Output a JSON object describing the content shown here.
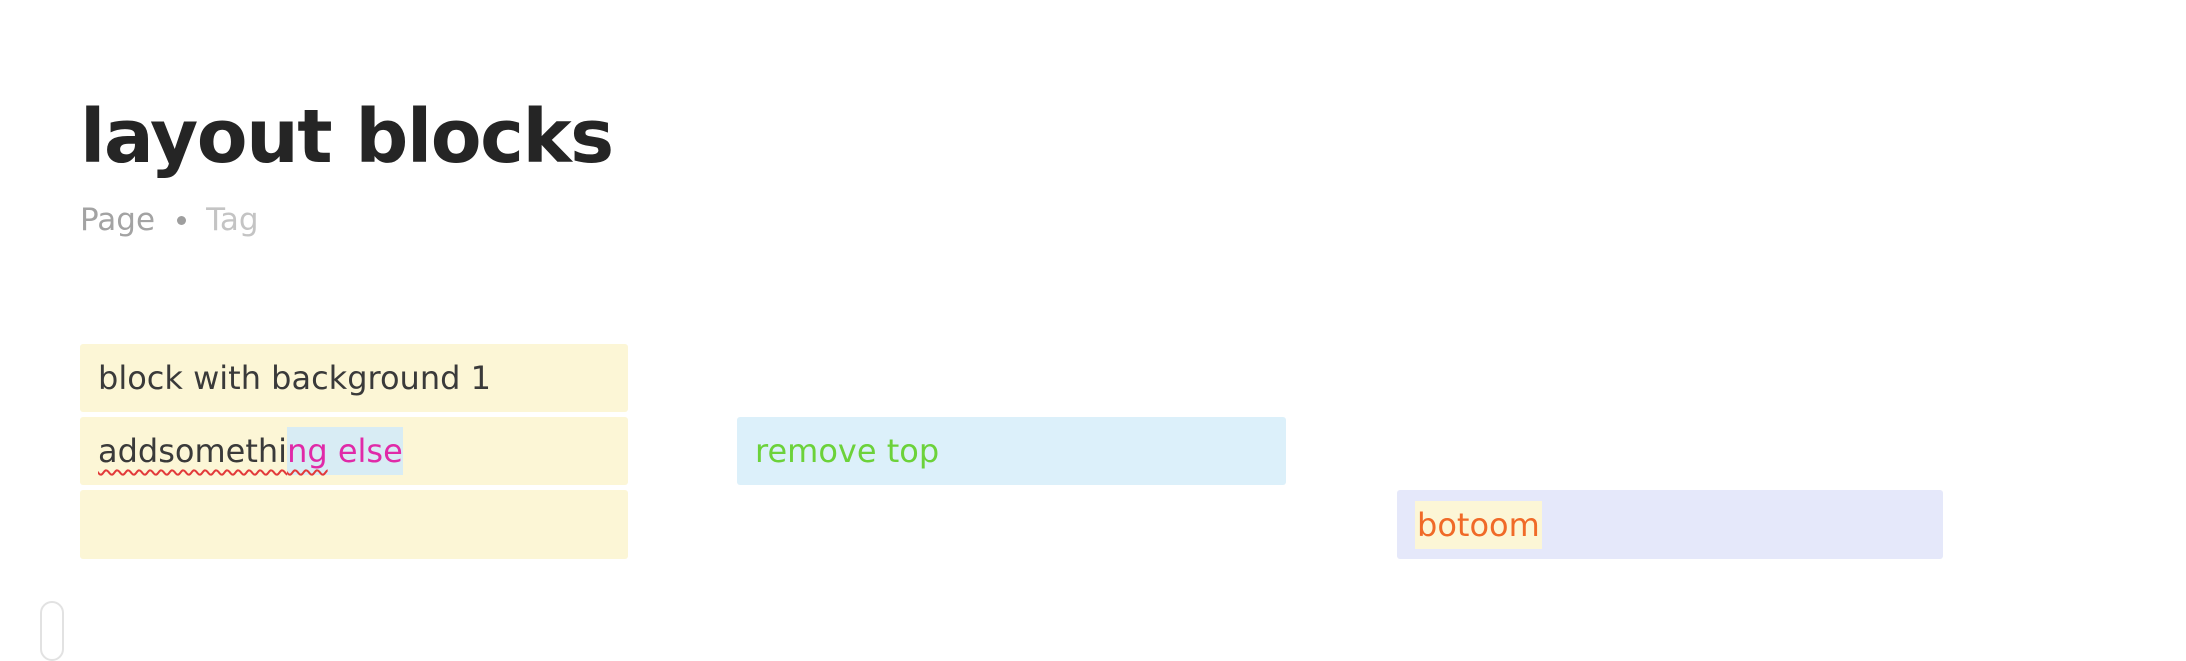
{
  "page": {
    "title": "layout blocks",
    "meta": {
      "type": "Page",
      "tag": "Tag"
    }
  },
  "blocks": {
    "block1": {
      "text": "block with background 1",
      "background": "#fcf6d6"
    },
    "block2": {
      "text_plain": "addsomethi",
      "text_highlight_underlined": "ng",
      "text_highlight_rest": " else",
      "text_color": "#e02aa8",
      "highlight": "#d8ecf4",
      "background": "#fcf6d6"
    },
    "block3": {
      "text": "",
      "background": "#fcf6d6"
    },
    "block4": {
      "text": "remove top",
      "text_color": "#6cd23a",
      "background": "#dcf0fa"
    },
    "block5": {
      "text": "botoom",
      "text_color": "#f06a28",
      "highlight": "#fcf6d6",
      "background": "#e5e8fa"
    }
  },
  "icons": {
    "drag_handle": "drag-handle-icon"
  }
}
